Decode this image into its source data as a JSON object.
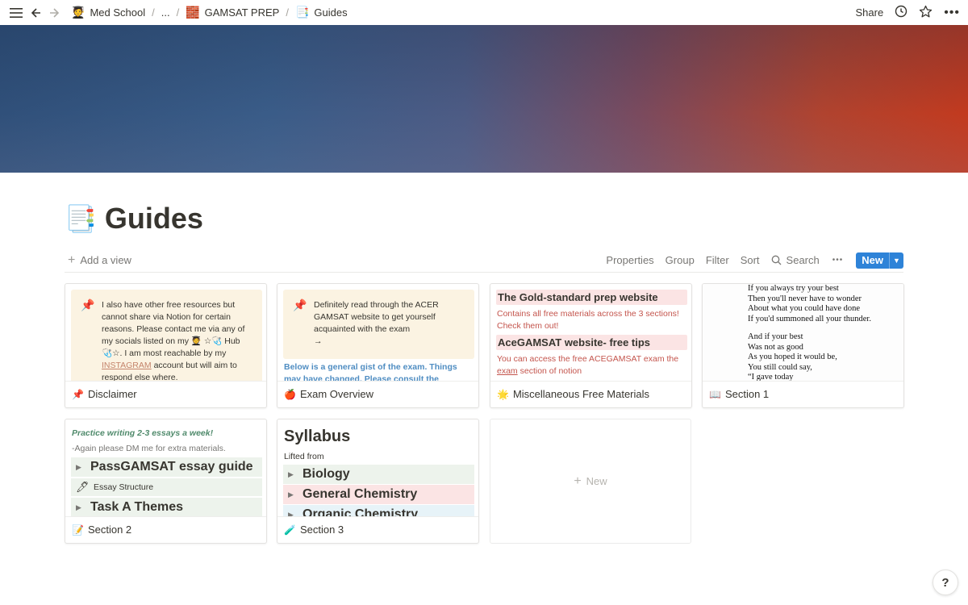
{
  "breadcrumb": [
    {
      "icon": "🧑‍🎓",
      "label": "Med School"
    },
    {
      "label": "..."
    },
    {
      "icon": "🧱",
      "label": "GAMSAT PREP"
    },
    {
      "icon": "📑",
      "label": "Guides"
    }
  ],
  "topbar": {
    "share_label": "Share"
  },
  "page": {
    "icon": "📑",
    "title": "Guides"
  },
  "viewbar": {
    "add_view": "Add a view",
    "properties": "Properties",
    "group": "Group",
    "filter": "Filter",
    "sort": "Sort",
    "search": "Search",
    "more": "•••",
    "new_label": "New"
  },
  "cards": {
    "disclaimer": {
      "callout_text_1": "I also have other free resources but cannot share via Notion for certain reasons. Please contact me via any of my socials listed on my 🧑‍🎓 ☆🩺 Hub 🩺☆. I am most reachable by my",
      "callout_link": "INSTAGRAM",
      "callout_text_2": "account but will aim to respond else where.",
      "footer_icon": "📌",
      "title": "Disclaimer"
    },
    "exam_overview": {
      "callout_text": "Definitely read through the ACER GAMSAT website to get yourself acquainted with the exam",
      "callout_arrow": "→",
      "note": "Below is a general gist of the exam. Things may have changed. Please consult the website.",
      "footer_icon": "🍎",
      "title": "Exam Overview"
    },
    "misc": {
      "heading_1": "The Gold-standard prep website",
      "text_1": "Contains all free materials across the 3 sections! Check them out!",
      "heading_2": "AceGAMSAT website- free tips",
      "text_2a": "You can access the free ACEGAMSAT exam the",
      "text_2_link": "exam",
      "text_2b": "section of notion",
      "footer_icon": "🌟",
      "title": "Miscellaneous Free Materials"
    },
    "section1": {
      "poem_1": [
        "If you always try your best",
        "Then you'll never have to wonder",
        "About what you could have done",
        "If you'd summoned all your thunder."
      ],
      "poem_2": [
        "And if your best",
        "Was not as good",
        "As you hoped it would be,",
        "You still could say,",
        "“I gave today"
      ],
      "footer_icon": "📖",
      "title": "Section 1"
    },
    "section2": {
      "practice": "Practice writing 2-3 essays a week!",
      "note": "-Again please DM me for extra materials.",
      "toggle_1": "PassGAMSAT essay guide",
      "toggle_2": "Essay Structure",
      "toggle_3": "Task A Themes",
      "footer_icon": "📝",
      "title": "Section 2"
    },
    "section3": {
      "heading": "Syllabus",
      "subtext": "Lifted from",
      "toggle_1": "Biology",
      "toggle_2": "General Chemistry",
      "toggle_3": "Organic Chemistry",
      "footer_icon": "🧪",
      "title": "Section 3"
    }
  },
  "new_card_label": "New",
  "help_label": "?",
  "colors": {
    "accent": "#2e83d8",
    "callout_bg": "#fbf3e2",
    "red_text": "#c4554d",
    "blue_text": "#4f8dc2"
  }
}
